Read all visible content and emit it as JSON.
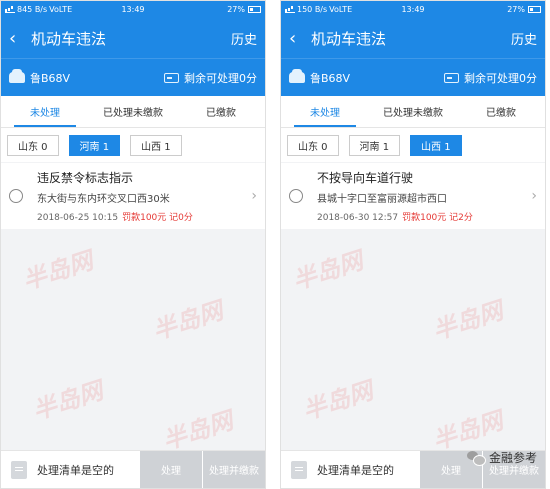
{
  "screens": [
    {
      "status": {
        "network": "845 B/s",
        "carrier": "VoLTE",
        "time": "13:49",
        "battery": "27%"
      },
      "header": {
        "back": "‹",
        "title": "机动车违法",
        "history": "历史"
      },
      "info": {
        "plate": "鲁B68V",
        "remaining": "剩余可处理0分"
      },
      "tabs": [
        "未处理",
        "已处理未缴款",
        "已缴款"
      ],
      "active_tab": 0,
      "regions": [
        "山东 0",
        "河南 1",
        "山西 1"
      ],
      "active_region": 1,
      "violation": {
        "title": "违反禁令标志指示",
        "address": "东大街与东内环交叉口西30米",
        "datetime": "2018-06-25 10:15",
        "penalty": "罚款100元 记0分"
      },
      "bottom": {
        "empty_text": "处理清单是空的",
        "button1": "处理",
        "button2": "处理并缴款"
      }
    },
    {
      "status": {
        "network": "150 B/s",
        "carrier": "VoLTE",
        "time": "13:49",
        "battery": "27%"
      },
      "header": {
        "back": "‹",
        "title": "机动车违法",
        "history": "历史"
      },
      "info": {
        "plate": "鲁B68V",
        "remaining": "剩余可处理0分"
      },
      "tabs": [
        "未处理",
        "已处理未缴款",
        "已缴款"
      ],
      "active_tab": 0,
      "regions": [
        "山东 0",
        "河南 1",
        "山西 1"
      ],
      "active_region": 2,
      "violation": {
        "title": "不按导向车道行驶",
        "address": "县城十字口至富丽源超市西口",
        "datetime": "2018-06-30 12:57",
        "penalty": "罚款100元 记2分"
      },
      "bottom": {
        "empty_text": "处理清单是空的",
        "button1": "处理",
        "button2": "处理并缴款"
      }
    }
  ],
  "watermark_text": "半岛网",
  "wechat": {
    "name": "金融参考",
    "icon": "wechat-icon"
  },
  "colors": {
    "primary": "#1e88e5",
    "fine": "#e53935"
  }
}
